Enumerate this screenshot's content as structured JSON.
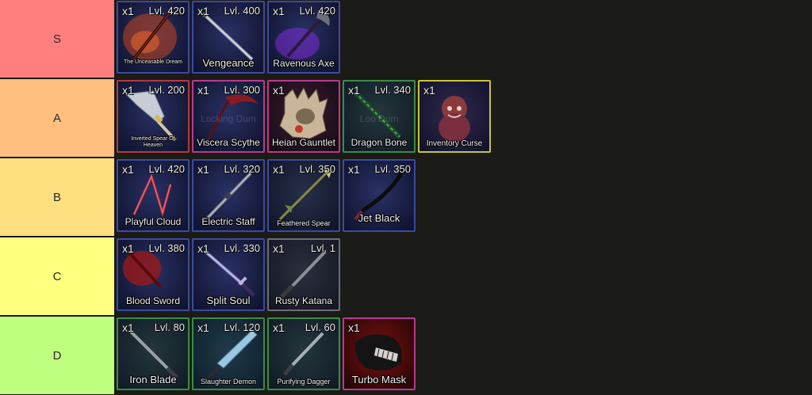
{
  "tiers": [
    {
      "label": "S",
      "color": "#ff7f7f",
      "items": [
        {
          "qty": "x1",
          "level": "Lvl. 420",
          "name": "The Unceasable Dream",
          "style": "blue",
          "art": "fire-sword-icon"
        },
        {
          "qty": "x1",
          "level": "Lvl. 400",
          "name": "Vengeance",
          "style": "blue",
          "art": "curved-blade-icon"
        },
        {
          "qty": "x1",
          "level": "Lvl. 420",
          "name": "Ravenous Axe",
          "style": "blue",
          "art": "purple-axe-icon"
        }
      ]
    },
    {
      "label": "A",
      "color": "#ffbf7f",
      "items": [
        {
          "qty": "x1",
          "level": "Lvl. 200",
          "name": "Inverted Spear Of Heaven",
          "style": "red",
          "art": "spear-icon"
        },
        {
          "qty": "x1",
          "level": "Lvl. 300",
          "name": "Viscera Scythe",
          "style": "pink",
          "art": "scythe-icon",
          "ghost": "Locking Dum"
        },
        {
          "qty": "x1",
          "level": "",
          "name": "Heian Gauntlet",
          "style": "pink",
          "art": "gauntlet-icon"
        },
        {
          "qty": "x1",
          "level": "Lvl. 340",
          "name": "Dragon Bone",
          "style": "green",
          "art": "bone-staff-icon",
          "ghost": "Loo Dum"
        },
        {
          "qty": "x1",
          "level": "",
          "name": "Inventory Curse",
          "style": "yellow",
          "art": "curse-creature-icon"
        }
      ]
    },
    {
      "label": "B",
      "color": "#ffdf7f",
      "items": [
        {
          "qty": "x1",
          "level": "Lvl. 420",
          "name": "Playful Cloud",
          "style": "blue",
          "art": "triple-staff-icon"
        },
        {
          "qty": "x1",
          "level": "Lvl. 320",
          "name": "Electric Staff",
          "style": "blue",
          "art": "staff-icon"
        },
        {
          "qty": "x1",
          "level": "Lvl. 350",
          "name": "Feathered Spear",
          "style": "blue",
          "art": "feather-spear-icon"
        },
        {
          "qty": "x1",
          "level": "Lvl. 350",
          "name": "Jet Black",
          "style": "blue",
          "art": "black-sword-icon"
        }
      ]
    },
    {
      "label": "C",
      "color": "#ffff7f",
      "items": [
        {
          "qty": "x1",
          "level": "Lvl. 380",
          "name": "Blood Sword",
          "style": "blue",
          "art": "blood-sword-icon"
        },
        {
          "qty": "x1",
          "level": "Lvl. 330",
          "name": "Split Soul",
          "style": "blue",
          "art": "katana-icon"
        },
        {
          "qty": "x1",
          "level": "Lvl. 1",
          "name": "Rusty Katana",
          "style": "gray",
          "art": "rusty-katana-icon"
        }
      ]
    },
    {
      "label": "D",
      "color": "#bfff7f",
      "items": [
        {
          "qty": "x1",
          "level": "Lvl. 80",
          "name": "Iron Blade",
          "style": "green",
          "art": "iron-blade-icon"
        },
        {
          "qty": "x1",
          "level": "Lvl. 120",
          "name": "Slaughter Demon",
          "style": "green",
          "art": "demon-sword-icon"
        },
        {
          "qty": "x1",
          "level": "Lvl. 60",
          "name": "Purifying Dagger",
          "style": "green",
          "art": "dagger-icon"
        },
        {
          "qty": "x1",
          "level": "",
          "name": "Turbo Mask",
          "style": "redbg",
          "art": "mask-icon"
        }
      ]
    }
  ]
}
